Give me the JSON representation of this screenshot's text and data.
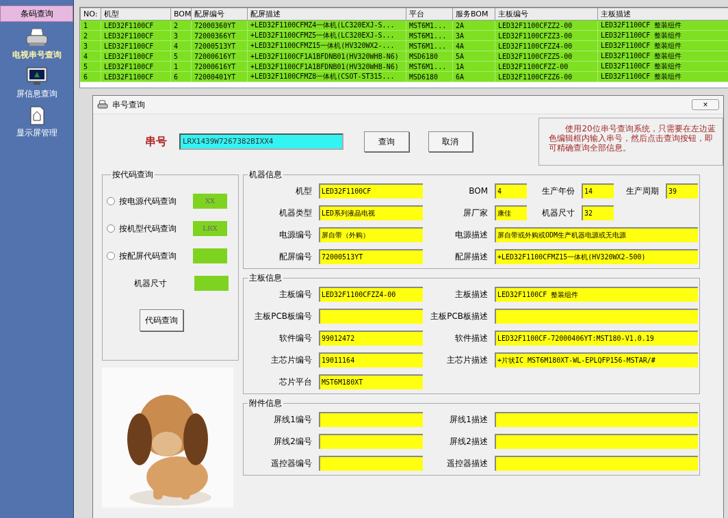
{
  "sidebar": {
    "header": "条码查询",
    "items": [
      {
        "label": "电视串号查询",
        "selected": true
      },
      {
        "label": "屏信息查询",
        "selected": false
      },
      {
        "label": "显示屏管理",
        "selected": false
      }
    ]
  },
  "table": {
    "columns": [
      "NO:",
      "机型",
      "BOM",
      "配屏编号",
      "配屏描述",
      "平台",
      "服务BOM",
      "主板编号",
      "主板描述"
    ],
    "rows": [
      {
        "cells": [
          "1",
          "LED32F1100CF",
          "2",
          "72000360YT",
          "+LED32F1100CFMZ4一体机(LC320EXJ-S...",
          "MST6M1...",
          "2A",
          "LED32F1100CFZZ2-00",
          "LED32F1100CF 整装组件"
        ]
      },
      {
        "cells": [
          "2",
          "LED32F1100CF",
          "3",
          "72000366YT",
          "+LED32F1100CFMZ5一体机(LC320EXJ-S...",
          "MST6M1...",
          "3A",
          "LED32F1100CFZZ3-00",
          "LED32F1100CF 整装组件"
        ]
      },
      {
        "cells": [
          "3",
          "LED32F1100CF",
          "4",
          "72000513YT",
          "+LED32F1100CFMZ15一体机(HV320WX2-...",
          "MST6M1...",
          "4A",
          "LED32F1100CFZZ4-00",
          "LED32F1100CF 整装组件"
        ]
      },
      {
        "cells": [
          "4",
          "LED32F1100CF",
          "5",
          "72000616YT",
          "+LED32F1100CF1A1BFDNB01(HV320WHB-N6)",
          "MSD6180",
          "5A",
          "LED32F1100CFZZ5-00",
          "LED32F1100CF 整装组件"
        ]
      },
      {
        "cells": [
          "5",
          "LED32F1100CF",
          "1",
          "72000616YT",
          "+LED32F1100CF1A1BFDNB01(HV320WHB-N6)",
          "MST6M1...",
          "1A",
          "LED32F1100CFZZ-00",
          "LED32F1100CF 整装组件"
        ]
      },
      {
        "cells": [
          "6",
          "LED32F1100CF",
          "6",
          "72000401YT",
          "+LED32F1100CFMZ8一体机(CSOT-ST315...",
          "MSD6180",
          "6A",
          "LED32F1100CFZZ6-00",
          "LED32F1100CF 整装组件"
        ]
      }
    ]
  },
  "dialog": {
    "title": "串号查询",
    "close": "×",
    "serial": {
      "label": "串号",
      "value": "LRX1439W7267382BIXX4"
    },
    "buttons": [
      "查询",
      "取消"
    ],
    "note": "使用20位串号查询系统，只需要在左边蓝色编辑框内输入串号，然后点击查询按钮，即可精确查询全部信息。",
    "code_query": {
      "legend": "按代码查询",
      "options": [
        {
          "label": "按电源代码查询",
          "code": "XX",
          "selected": false
        },
        {
          "label": "按机型代码查询",
          "code": "LRX",
          "selected": false
        },
        {
          "label": "按配屏代码查询",
          "selected": false
        }
      ],
      "size_label": "机器尺寸",
      "button": "代码查询"
    },
    "sections": [
      {
        "legend": "机器信息",
        "rows": [
          [
            {
              "label": "机型",
              "value": "LED32F1100CF",
              "kind": "medium"
            },
            {
              "label": "BOM",
              "value": "4",
              "kind": "short"
            },
            {
              "label": "生产年份",
              "value": "14",
              "kind": "short"
            },
            {
              "label": "生产周期",
              "value": "39",
              "kind": "short"
            }
          ],
          [
            {
              "label": "机器类型",
              "value": "LED系列液晶电视",
              "kind": "medium"
            },
            {
              "label": "屏厂家",
              "value": "康佳",
              "kind": "short"
            },
            {
              "label": "机器尺寸",
              "value": "32",
              "kind": "short"
            }
          ],
          [
            {
              "label": "电源编号",
              "value": "屏自带（外购）",
              "kind": "medium"
            },
            {
              "label": "电源描述",
              "value": "屏自带或外购或ODM生产机器电源或无电源",
              "kind": "long"
            }
          ],
          [
            {
              "label": "配屏编号",
              "value": "72000513YT",
              "kind": "medium"
            },
            {
              "label": "配屏描述",
              "value": "+LED32F1100CFMZ15一体机(HV320WX2-500)",
              "kind": "long"
            }
          ]
        ]
      },
      {
        "legend": "主板信息",
        "rows": [
          [
            {
              "label": "主板编号",
              "value": "LED32F1100CFZZ4-00",
              "kind": "medium"
            },
            {
              "label": "主板描述",
              "value": "LED32F1100CF 整装组件",
              "kind": "long"
            }
          ],
          [
            {
              "label": "主板PCB板编号",
              "kind": "medium"
            },
            {
              "label": "主板PCB板描述",
              "kind": "long"
            }
          ],
          [
            {
              "label": "软件编号",
              "value": "99012472",
              "kind": "medium"
            },
            {
              "label": "软件描述",
              "value": "LED32F1100CF-72000406YT:MST180-V1.0.19",
              "kind": "long"
            }
          ],
          [
            {
              "label": "主芯片编号",
              "value": "19011164",
              "kind": "medium"
            },
            {
              "label": "主芯片描述",
              "value": "+片状IC MST6M180XT-WL-EPLQFP156-MSTAR/#",
              "kind": "long"
            }
          ],
          [
            {
              "label": "芯片平台",
              "value": "MST6M180XT",
              "kind": "medium"
            }
          ]
        ]
      },
      {
        "legend": "附件信息",
        "rows": [
          [
            {
              "label": "屏线1编号",
              "kind": "medium"
            },
            {
              "label": "屏线1描述",
              "kind": "long"
            }
          ],
          [
            {
              "label": "屏线2编号",
              "kind": "medium"
            },
            {
              "label": "屏线2描述",
              "kind": "long"
            }
          ],
          [
            {
              "label": "遥控器编号",
              "kind": "medium"
            },
            {
              "label": "遥控器描述",
              "kind": "long"
            }
          ]
        ]
      }
    ]
  }
}
